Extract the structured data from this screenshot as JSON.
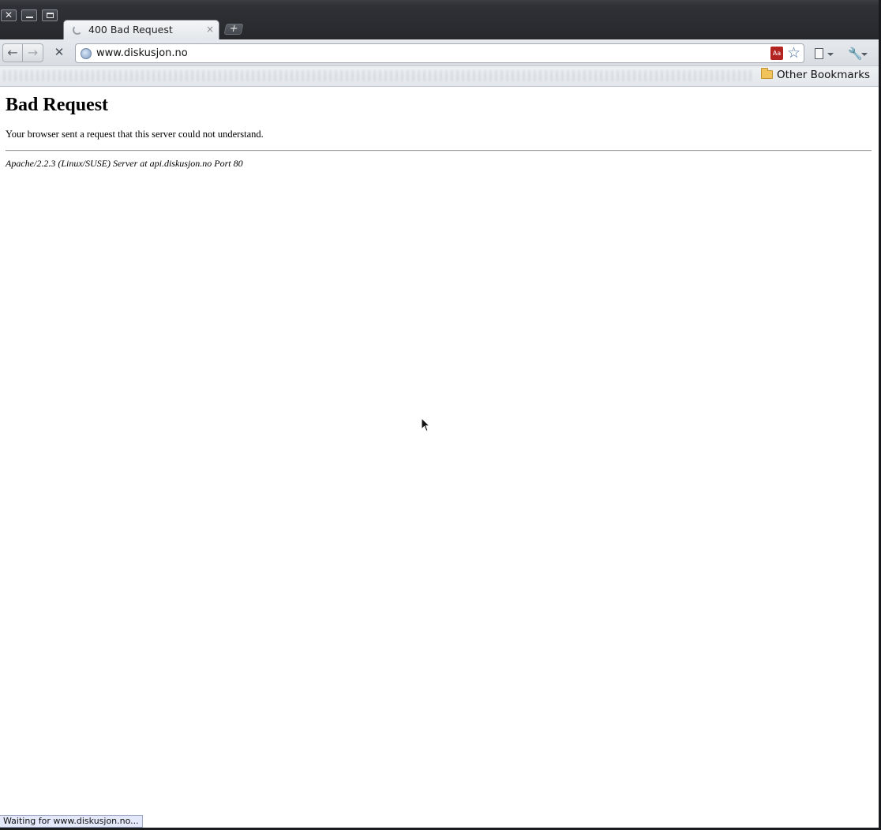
{
  "window": {
    "controls": [
      "close-icon",
      "minimize-icon",
      "maximize-icon"
    ]
  },
  "tab": {
    "title": "400 Bad Request",
    "close_glyph": "×",
    "new_tab_glyph": "+"
  },
  "toolbar": {
    "back_glyph": "←",
    "forward_glyph": "→",
    "stop_glyph": "✕",
    "url": "www.diskusjon.no",
    "extension_glyph": "Aa"
  },
  "bookmarks": {
    "other_label": "Other Bookmarks"
  },
  "page": {
    "heading": "Bad Request",
    "message": "Your browser sent a request that this server could not understand.",
    "server_signature": "Apache/2.2.3 (Linux/SUSE) Server at api.diskusjon.no Port 80"
  },
  "status": {
    "text": "Waiting for www.diskusjon.no..."
  },
  "colors": {
    "titlebar": "#2b2d31",
    "toolbar": "#e6e9ed",
    "status_bg": "#e3e9fb"
  }
}
